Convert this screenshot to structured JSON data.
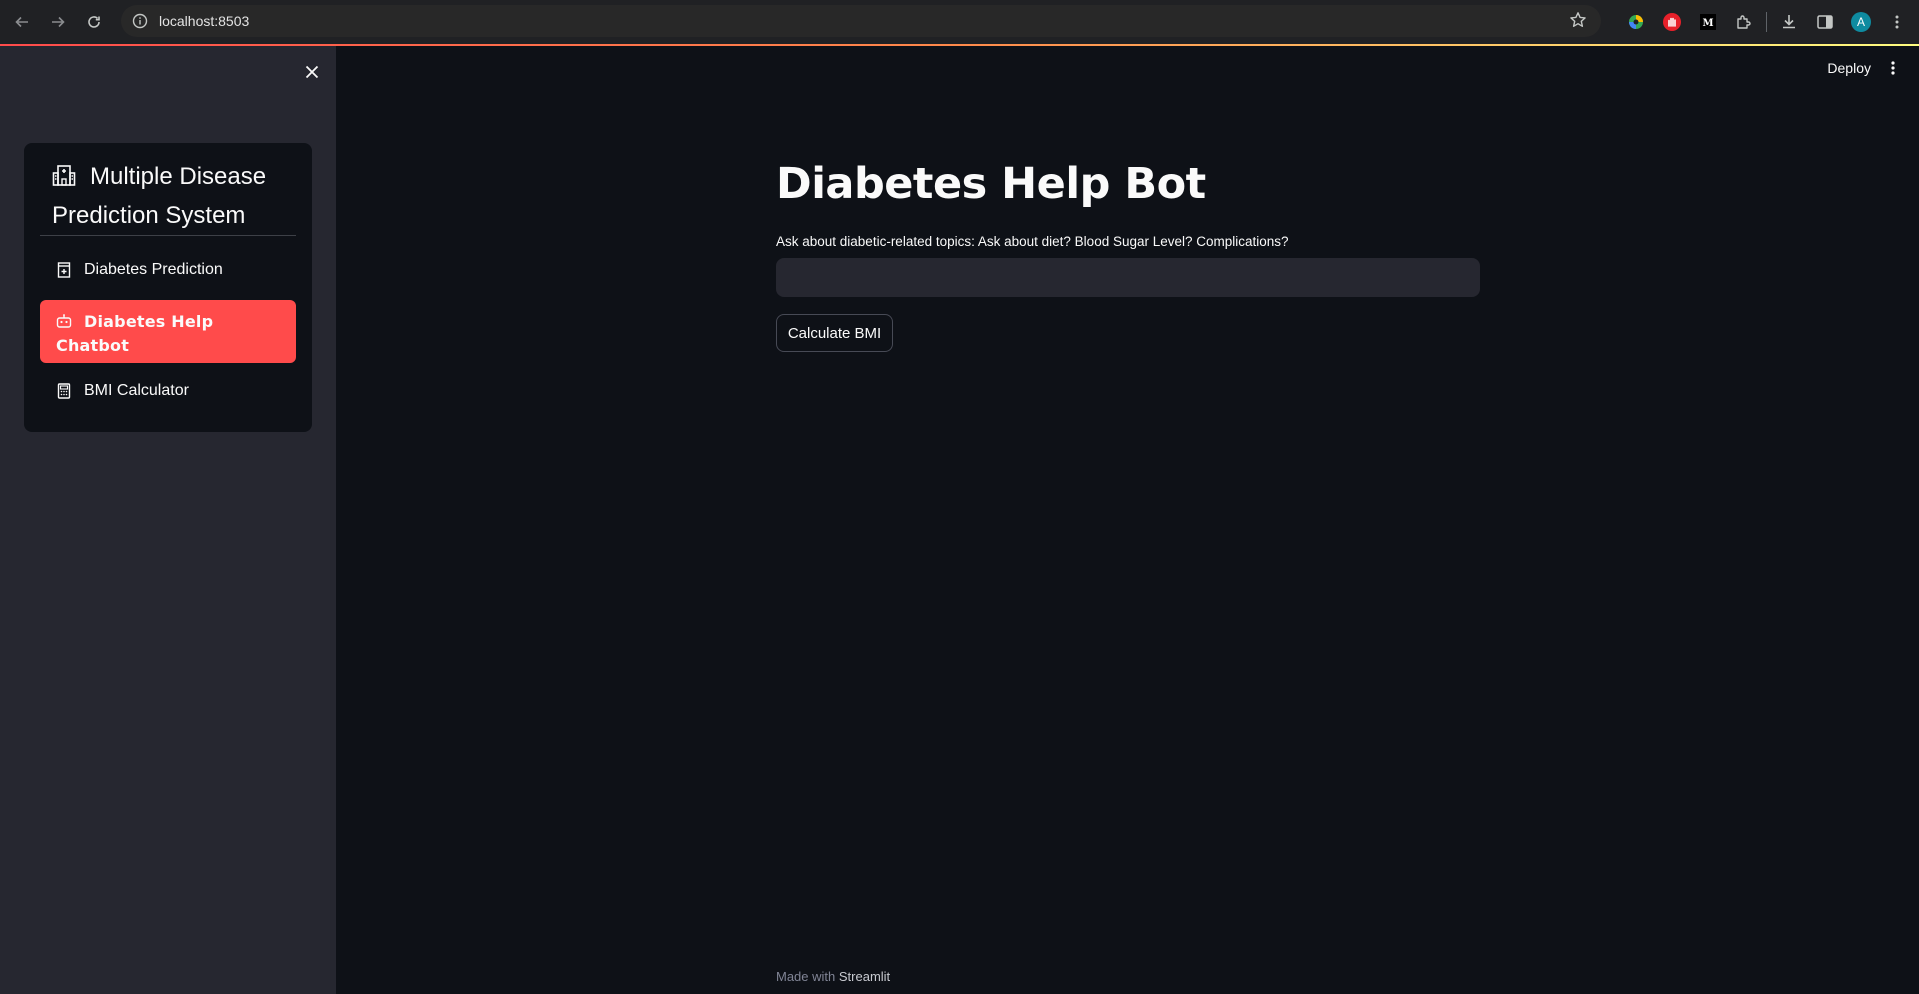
{
  "browser": {
    "url": "localhost:8503",
    "profile_initial": "A"
  },
  "sidebar": {
    "title": "Multiple Disease Prediction System",
    "items": [
      {
        "label": "Diabetes Prediction",
        "icon": "hospital-icon",
        "selected": false
      },
      {
        "label": "Diabetes Help Chatbot",
        "icon": "robot-icon",
        "selected": true
      },
      {
        "label": "BMI Calculator",
        "icon": "calculator-icon",
        "selected": false
      }
    ],
    "selected_color": "#ff4b4b"
  },
  "header": {
    "deploy_label": "Deploy"
  },
  "main": {
    "title": "Diabetes Help Bot",
    "question_label": "Ask about diabetic-related topics: Ask about diet? Blood Sugar Level? Complications?",
    "question_value": "",
    "button_label": "Calculate BMI"
  },
  "footer": {
    "prefix": "Made with",
    "brand": "Streamlit"
  }
}
